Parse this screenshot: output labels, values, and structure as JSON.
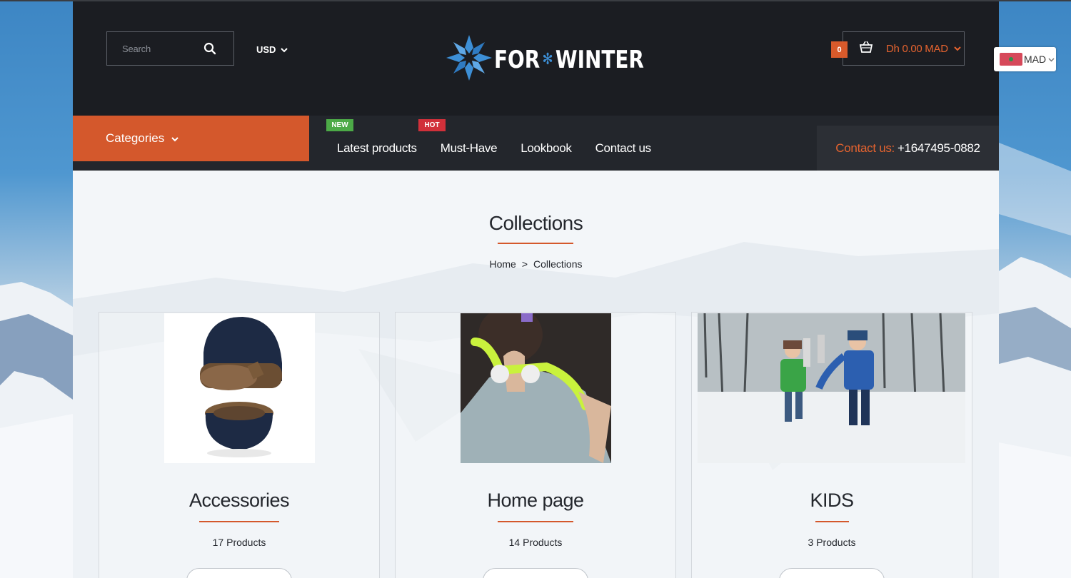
{
  "header": {
    "search_placeholder": "Search",
    "currency": "USD",
    "logo_left": "FOR",
    "logo_right": "WINTER",
    "cart_count": "0",
    "cart_total": "Dh 0.00 MAD"
  },
  "nav": {
    "categories_label": "Categories",
    "items": [
      {
        "label": "Latest products",
        "badge": "NEW"
      },
      {
        "label": "Must-Have",
        "badge": "HOT"
      },
      {
        "label": "Lookbook"
      },
      {
        "label": "Contact us"
      }
    ],
    "contact_label": "Contact us:",
    "contact_phone": "+1647495-0882"
  },
  "main": {
    "title": "Collections",
    "breadcrumb": {
      "home": "Home",
      "separator": ">",
      "current": "Collections"
    }
  },
  "collections": [
    {
      "title": "Accessories",
      "count": "17 Products"
    },
    {
      "title": "Home page",
      "count": "14 Products"
    },
    {
      "title": "KIDS",
      "count": "3 Products"
    }
  ],
  "language": {
    "code": "MAD"
  },
  "colors": {
    "accent": "#d4582c",
    "header_bg": "#1b1d22",
    "new_badge": "#4caa47",
    "hot_badge": "#d1303a"
  },
  "icons": [
    "search-icon",
    "chevron-down-icon",
    "basket-icon",
    "snowflake-logo-icon",
    "flag-icon"
  ]
}
